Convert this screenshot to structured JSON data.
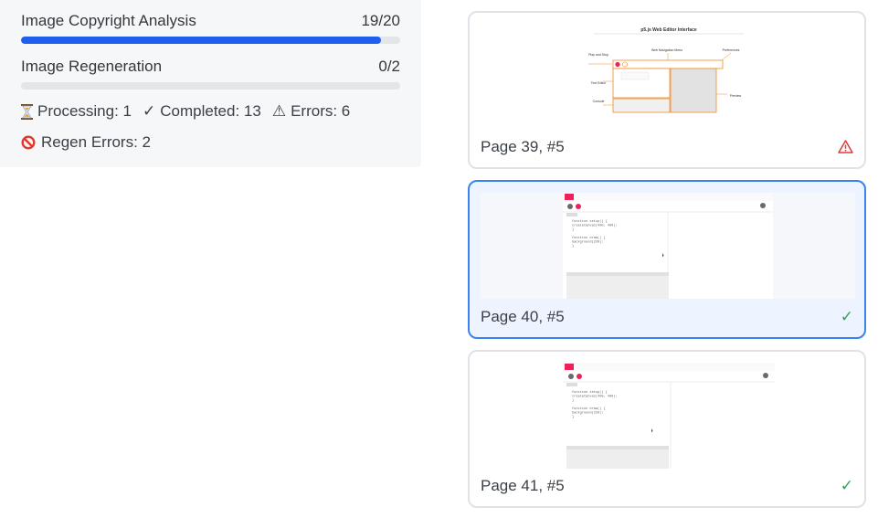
{
  "progress": {
    "tasks": [
      {
        "label": "Image Copyright Analysis",
        "count": "19/20",
        "fraction": 0.95
      },
      {
        "label": "Image Regeneration",
        "count": "0/2",
        "fraction": 0.0
      }
    ],
    "status": {
      "processing": "Processing: 1",
      "completed": "Completed: 13",
      "errors": "Errors: 6",
      "regen_errors": "Regen Errors: 2"
    }
  },
  "cards": [
    {
      "label": "Page 39, #5",
      "status": "error",
      "thumb": {
        "title": "p5.js Web Editor Interface",
        "callouts": [
          "Web Navigation Menu",
          "Preferences",
          "Play and Stop",
          "Text Editor",
          "Console",
          "Preview"
        ]
      }
    },
    {
      "label": "Page 40, #5",
      "status": "ok",
      "selected": true,
      "thumb": {
        "code": [
          "function setup() {",
          "  createCanvas(400, 400);",
          "}",
          "",
          "function draw() {",
          "  background(220);",
          "}"
        ]
      }
    },
    {
      "label": "Page 41, #5",
      "status": "ok",
      "thumb": {
        "code": [
          "function setup() {",
          "  createCanvas(400, 400);",
          "}",
          "",
          "function draw() {",
          "  background(220);",
          "}"
        ]
      }
    }
  ],
  "colors": {
    "accent": "#1f5ff0",
    "selected_border": "#3a82f0",
    "ok": "#2ea44f",
    "error": "#e03a3a",
    "p5_red": "#ed225d"
  },
  "icons": {
    "processing": "hourglass-icon",
    "completed": "check-icon",
    "errors": "warning-icon",
    "regen_errors": "ban-icon",
    "card_ok": "check-icon",
    "card_error": "warning-icon"
  }
}
